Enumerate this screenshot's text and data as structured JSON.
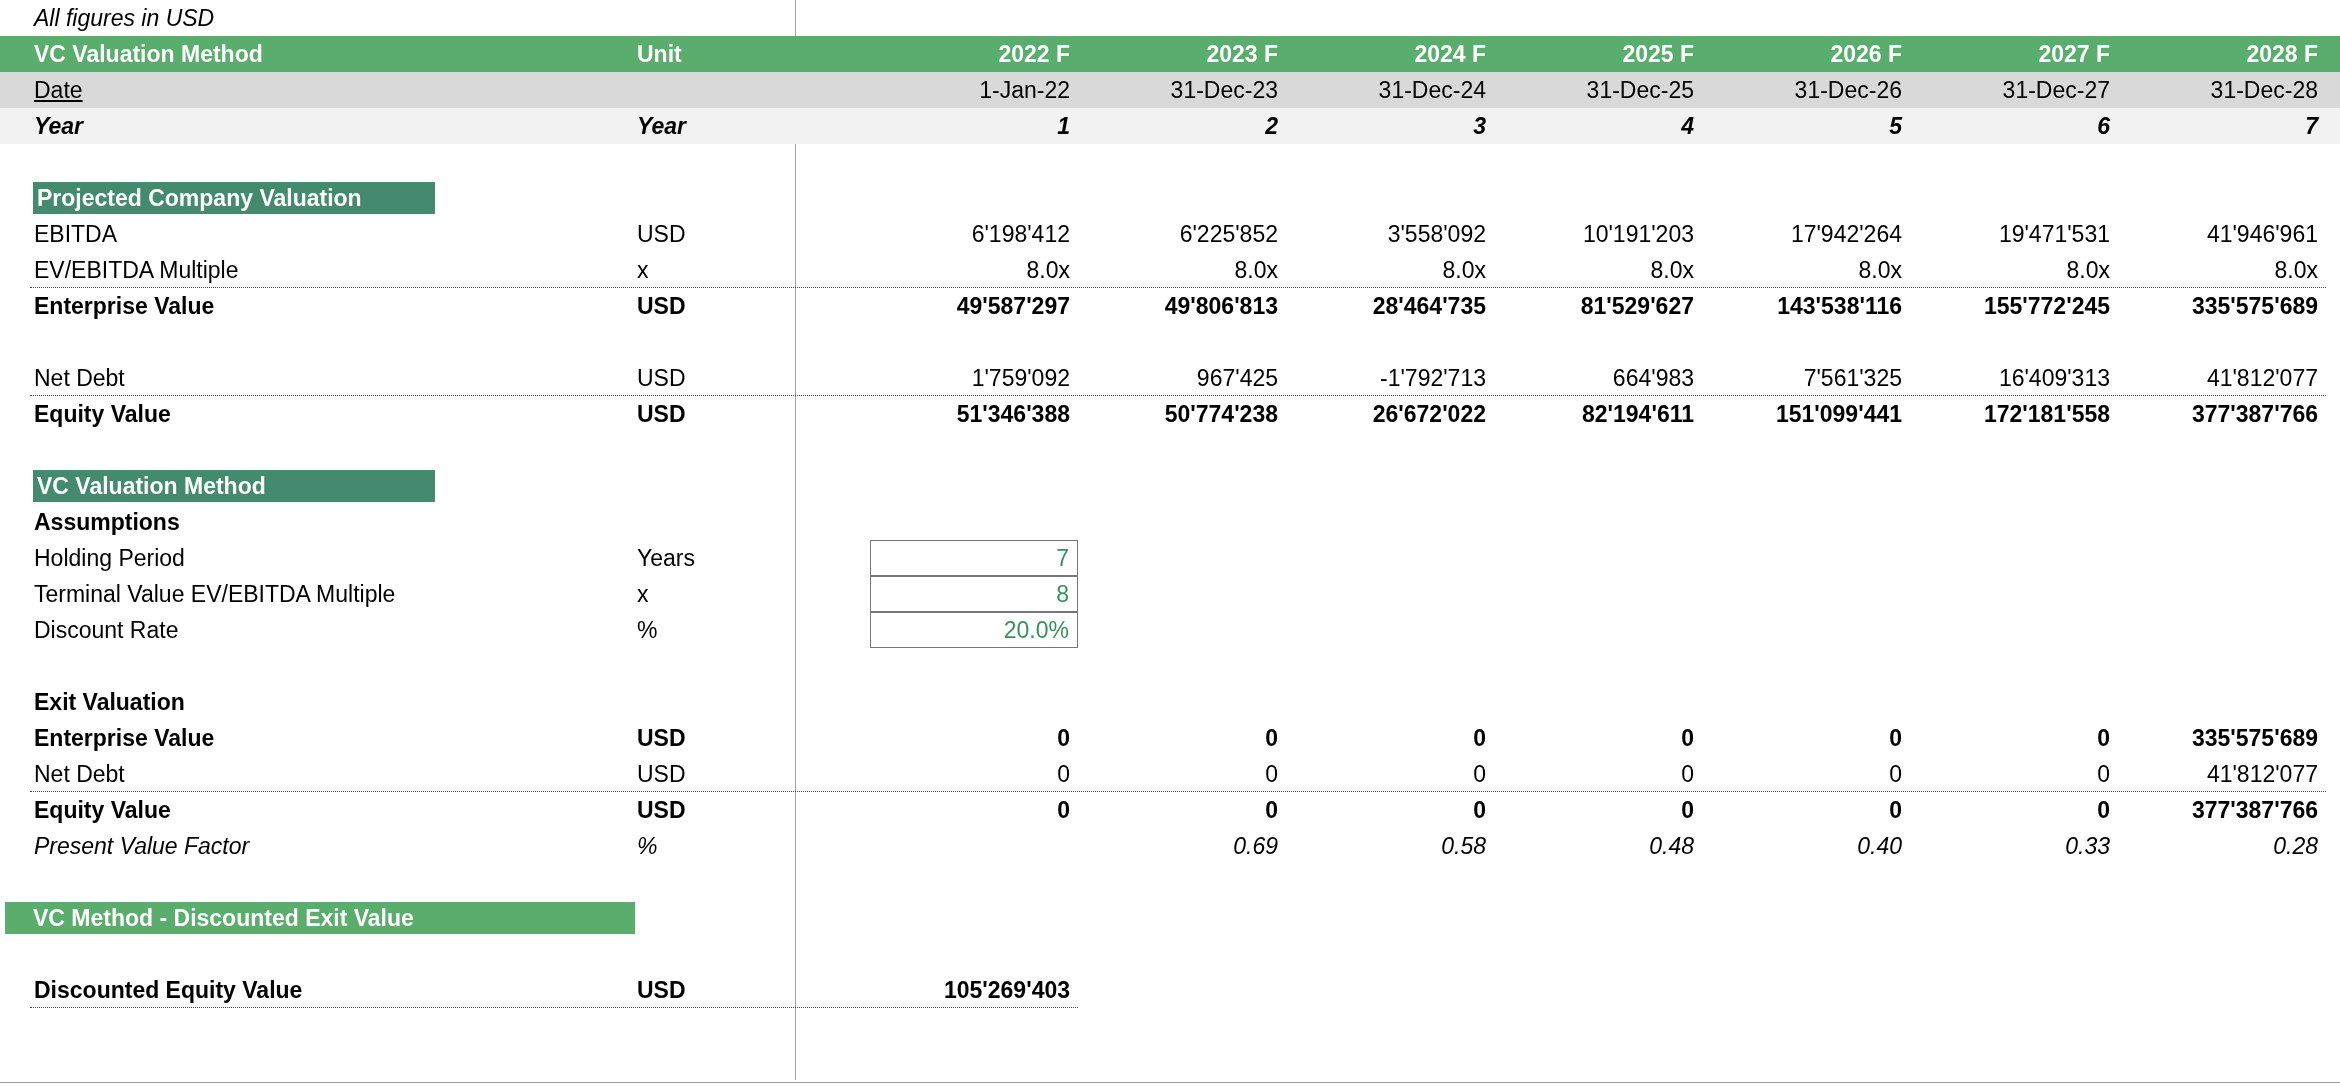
{
  "note": "All figures in USD",
  "blocks": [
    {
      "rows": [
        {
          "kind": "header",
          "label": "VC Valuation Method",
          "unit": "Unit",
          "values": [
            "2022 F",
            "2023 F",
            "2024 F",
            "2025 F",
            "2026 F",
            "2027 F",
            "2028 F"
          ]
        },
        {
          "kind": "date",
          "label": "Date",
          "values": [
            "1-Jan-22",
            "31-Dec-23",
            "31-Dec-24",
            "31-Dec-25",
            "31-Dec-26",
            "31-Dec-27",
            "31-Dec-28"
          ]
        },
        {
          "kind": "year",
          "label": "Year",
          "unit": "Year",
          "values": [
            "1",
            "2",
            "3",
            "4",
            "5",
            "6",
            "7"
          ]
        }
      ]
    },
    {
      "rows": [
        {
          "kind": "section",
          "label": "Projected Company Valuation"
        },
        {
          "kind": "data",
          "label": "EBITDA",
          "unit": "USD",
          "bold": false,
          "italic": false,
          "rule_below": false,
          "values": [
            "6'198'412",
            "6'225'852",
            "3'558'092",
            "10'191'203",
            "17'942'264",
            "19'471'531",
            "41'946'961"
          ]
        },
        {
          "kind": "data",
          "label": "EV/EBITDA Multiple",
          "unit": "x",
          "bold": false,
          "italic": false,
          "rule_below": true,
          "values": [
            "8.0x",
            "8.0x",
            "8.0x",
            "8.0x",
            "8.0x",
            "8.0x",
            "8.0x"
          ]
        },
        {
          "kind": "data",
          "label": "Enterprise Value",
          "unit": "USD",
          "bold": true,
          "italic": false,
          "rule_below": false,
          "values": [
            "49'587'297",
            "49'806'813",
            "28'464'735",
            "81'529'627",
            "143'538'116",
            "155'772'245",
            "335'575'689"
          ]
        }
      ]
    },
    {
      "rows": [
        {
          "kind": "data",
          "label": "Net Debt",
          "unit": "USD",
          "bold": false,
          "italic": false,
          "rule_below": true,
          "values": [
            "1'759'092",
            "967'425",
            "-1'792'713",
            "664'983",
            "7'561'325",
            "16'409'313",
            "41'812'077"
          ]
        },
        {
          "kind": "data",
          "label": "Equity Value",
          "unit": "USD",
          "bold": true,
          "italic": false,
          "rule_below": false,
          "values": [
            "51'346'388",
            "50'774'238",
            "26'672'022",
            "82'194'611",
            "151'099'441",
            "172'181'558",
            "377'387'766"
          ]
        }
      ]
    },
    {
      "rows": [
        {
          "kind": "section",
          "label": "VC Valuation Method"
        },
        {
          "kind": "subheading",
          "label": "Assumptions"
        },
        {
          "kind": "input",
          "label": "Holding Period",
          "unit": "Years",
          "values": [
            "7"
          ]
        },
        {
          "kind": "input",
          "label": "Terminal Value EV/EBITDA Multiple",
          "unit": "x",
          "values": [
            "8"
          ]
        },
        {
          "kind": "input",
          "label": "Discount Rate",
          "unit": "%",
          "values": [
            "20.0%"
          ]
        }
      ]
    },
    {
      "rows": [
        {
          "kind": "subheading",
          "label": "Exit Valuation"
        },
        {
          "kind": "data",
          "label": "Enterprise Value",
          "unit": "USD",
          "bold": true,
          "italic": false,
          "rule_below": false,
          "values": [
            "0",
            "0",
            "0",
            "0",
            "0",
            "0",
            "335'575'689"
          ]
        },
        {
          "kind": "data",
          "label": "Net Debt",
          "unit": "USD",
          "bold": false,
          "italic": false,
          "rule_below": true,
          "values": [
            "0",
            "0",
            "0",
            "0",
            "0",
            "0",
            "41'812'077"
          ]
        },
        {
          "kind": "data",
          "label": "Equity Value",
          "unit": "USD",
          "bold": true,
          "italic": false,
          "rule_below": false,
          "values": [
            "0",
            "0",
            "0",
            "0",
            "0",
            "0",
            "377'387'766"
          ]
        },
        {
          "kind": "data",
          "label": "Present Value Factor",
          "unit": "%",
          "bold": false,
          "italic": true,
          "rule_below": false,
          "first_blank": true,
          "values": [
            "0.69",
            "0.58",
            "0.48",
            "0.40",
            "0.33",
            "0.28"
          ]
        }
      ]
    },
    {
      "rows": [
        {
          "kind": "banner",
          "label": "VC Method - Discounted Exit Value"
        }
      ]
    },
    {
      "rows": [
        {
          "kind": "data",
          "label": "Discounted Equity Value",
          "unit": "USD",
          "bold": true,
          "italic": false,
          "rule_below": true,
          "values": [
            "105'269'403"
          ]
        }
      ]
    }
  ]
}
